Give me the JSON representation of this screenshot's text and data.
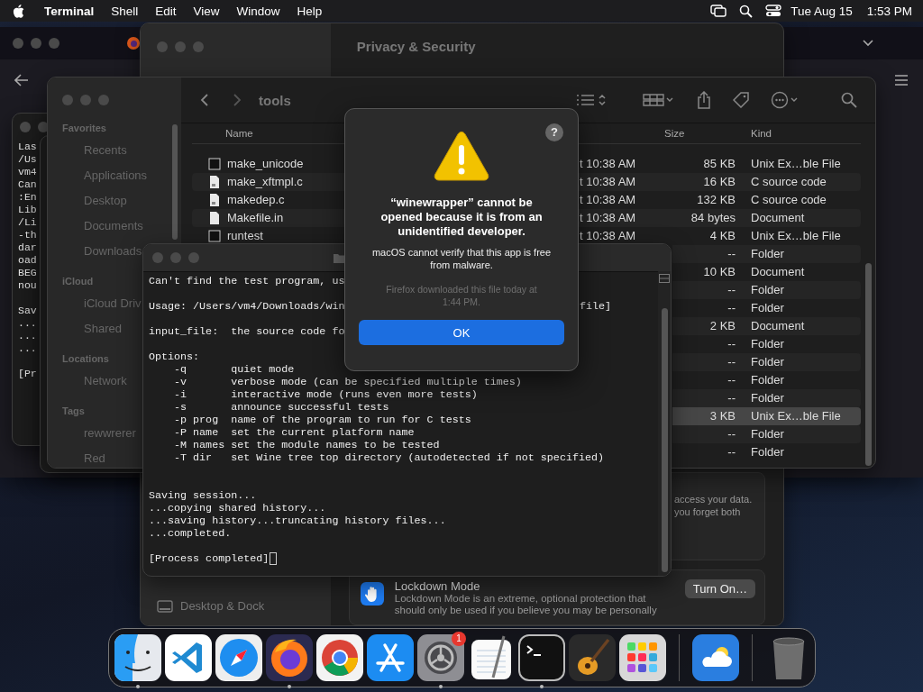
{
  "menu_bar": {
    "menus": [
      {
        "label": "Terminal",
        "kind": "app"
      },
      {
        "label": "Shell",
        "kind": "menu"
      },
      {
        "label": "Edit",
        "kind": "menu"
      },
      {
        "label": "View",
        "kind": "menu"
      },
      {
        "label": "Window",
        "kind": "menu"
      },
      {
        "label": "Help",
        "kind": "menu"
      }
    ],
    "date": "Tue Aug 15",
    "time": "1:53 PM"
  },
  "settings_window": {
    "title": "Privacy & Security",
    "sidebar_items": [
      "Desktop & Dock"
    ],
    "card_text": "access your data.\nyou forget both",
    "lockdown": {
      "title": "Lockdown Mode",
      "description": "Lockdown Mode is an extreme, optional protection that should only be used if you believe you may be personally",
      "button": "Turn On…"
    }
  },
  "background_terminal": {
    "blocks": [
      [
        "Las",
        "/Us",
        "vm4",
        "Can",
        ":En",
        "Lib",
        "/Li",
        "-th",
        "dar",
        "oad",
        "BEG",
        "nou"
      ],
      [
        "Sav",
        "...",
        "...",
        "..."
      ],
      [
        "[Pr"
      ]
    ]
  },
  "finder": {
    "title": "tools",
    "sidebar": [
      {
        "heading": "Favorites",
        "items": [
          "Recents",
          "Applications",
          "Desktop",
          "Documents",
          "Downloads"
        ]
      },
      {
        "heading": "iCloud",
        "items": [
          "iCloud Driv",
          "Shared"
        ]
      },
      {
        "heading": "Locations",
        "items": [
          "Network"
        ]
      },
      {
        "heading": "Tags",
        "items": [
          "rewwrerer",
          "Red"
        ]
      }
    ],
    "columns": [
      "Name",
      "Size",
      "Kind"
    ],
    "rows": [
      {
        "name": "make_unicode",
        "date": "t 10:38 AM",
        "size": "85 KB",
        "kind": "Unix Ex…ble File",
        "selected": false
      },
      {
        "name": "make_xftmpl.c",
        "date": "t 10:38 AM",
        "size": "16 KB",
        "kind": "C source code",
        "selected": false
      },
      {
        "name": "makedep.c",
        "date": "t 10:38 AM",
        "size": "132 KB",
        "kind": "C source code",
        "selected": false
      },
      {
        "name": "Makefile.in",
        "date": "t 10:38 AM",
        "size": "84 bytes",
        "kind": "Document",
        "selected": false
      },
      {
        "name": "runtest",
        "date": "t 10:38 AM",
        "size": "4 KB",
        "kind": "Unix Ex…ble File",
        "selected": false
      },
      {
        "size": "--",
        "kind": "Folder",
        "selected": false
      },
      {
        "size": "10 KB",
        "kind": "Document",
        "selected": false
      },
      {
        "size": "--",
        "kind": "Folder",
        "selected": false
      },
      {
        "size": "--",
        "kind": "Folder",
        "selected": false
      },
      {
        "size": "2 KB",
        "kind": "Document",
        "selected": false
      },
      {
        "size": "--",
        "kind": "Folder",
        "selected": false
      },
      {
        "size": "--",
        "kind": "Folder",
        "selected": false
      },
      {
        "size": "--",
        "kind": "Folder",
        "selected": false
      },
      {
        "size": "--",
        "kind": "Folder",
        "selected": false
      },
      {
        "size": "3 KB",
        "kind": "Unix Ex…ble File",
        "selected": true
      },
      {
        "size": "--",
        "kind": "Folder",
        "selected": false
      },
      {
        "size": "--",
        "kind": "Folder",
        "selected": false
      }
    ]
  },
  "terminal": {
    "lines": [
      {
        "text": "Can't find the test program, us"
      },
      {
        "text": "Usage: /Users/vm4/Downloads/win",
        "tail": "file]"
      },
      {
        "text": "input_file:  the source code fo"
      },
      {
        "text": "Options:"
      },
      {
        "text": "    -q       quiet mode"
      },
      {
        "text": "    -v       verbose mode (can be specified multiple times)"
      },
      {
        "text": "    -i       interactive mode (runs even more tests)"
      },
      {
        "text": "    -s       announce successful tests"
      },
      {
        "text": "    -p prog  name of the program to run for C tests"
      },
      {
        "text": "    -P name  set the current platform name"
      },
      {
        "text": "    -M names set the module names to be tested"
      },
      {
        "text": "    -T dir   set Wine tree top directory (autodetected if not specified)"
      },
      {
        "text": "Saving session..."
      },
      {
        "text": "...copying shared history..."
      },
      {
        "text": "...saving history...truncating history files..."
      },
      {
        "text": "...completed."
      },
      {
        "text": "[Process completed]",
        "cursor": true
      }
    ]
  },
  "dialog": {
    "help_button": "?",
    "title": "“winewrapper” cannot be opened because it is from an unidentified developer.",
    "message": "macOS cannot verify that this app is free from malware.",
    "note": "Firefox downloaded this file today at 1:44 PM.",
    "button": "OK"
  },
  "dock": {
    "sections": [
      [
        {
          "kind": "finder",
          "running": true
        },
        {
          "kind": "vscode",
          "running": false
        },
        {
          "kind": "safari",
          "running": false
        },
        {
          "kind": "firefox",
          "running": true
        },
        {
          "kind": "chrome",
          "running": false
        },
        {
          "kind": "appstore",
          "running": false
        },
        {
          "kind": "settings",
          "running": true,
          "badge": "1"
        },
        {
          "kind": "textedit",
          "running": false
        },
        {
          "kind": "terminal",
          "running": true
        },
        {
          "kind": "garageband",
          "running": false
        },
        {
          "kind": "launchpad",
          "running": false
        }
      ],
      [
        {
          "kind": "weather",
          "running": false
        }
      ],
      [
        {
          "kind": "trash",
          "running": false
        }
      ]
    ]
  }
}
